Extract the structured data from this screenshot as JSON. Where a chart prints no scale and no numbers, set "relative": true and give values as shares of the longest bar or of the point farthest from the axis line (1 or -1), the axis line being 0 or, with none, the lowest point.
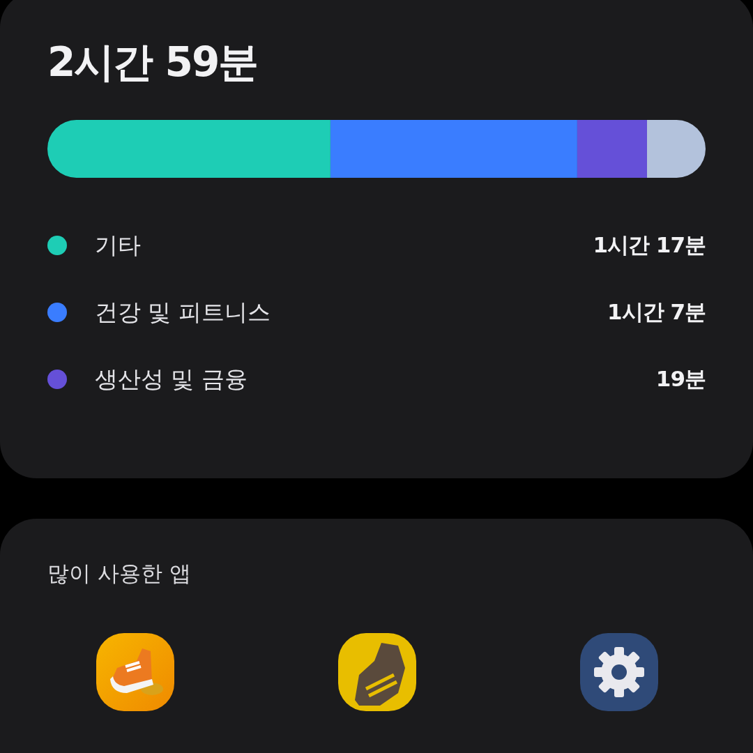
{
  "usage": {
    "total": "2시간 59분",
    "chart_data": {
      "type": "bar",
      "orientation": "horizontal",
      "stacked": true,
      "relative": true,
      "series": [
        {
          "name": "기타",
          "color": "#1ecdb5",
          "values": [
            0.43
          ]
        },
        {
          "name": "건강 및 피트니스",
          "color": "#3a7dff",
          "values": [
            0.375
          ]
        },
        {
          "name": "생산성 및 금융",
          "color": "#6550d8",
          "values": [
            0.106
          ]
        },
        {
          "color": "#b3c2dc",
          "values": [
            0.089
          ]
        }
      ]
    },
    "durations": [
      "1시간 17분",
      "1시간 7분",
      "19분"
    ]
  },
  "most_used": {
    "title": "많이 사용한 앱",
    "apps": [
      {
        "kind": "shoe"
      },
      {
        "kind": "sneaker"
      },
      {
        "kind": "gear"
      }
    ]
  }
}
